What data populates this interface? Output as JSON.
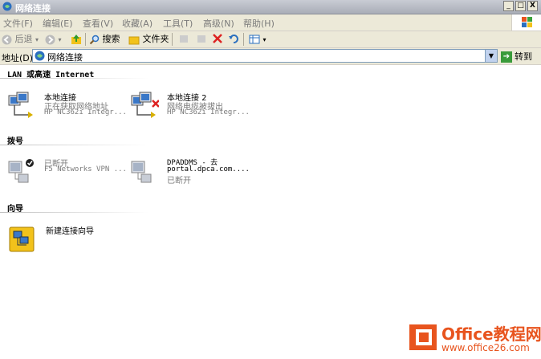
{
  "window": {
    "title": "网络连接",
    "minimize": "_",
    "maximize": "□",
    "close": "X"
  },
  "menu": [
    "文件(F)",
    "编辑(E)",
    "查看(V)",
    "收藏(A)",
    "工具(T)",
    "高级(N)",
    "帮助(H)"
  ],
  "toolbar": {
    "back": "后退",
    "search": "搜索",
    "folders": "文件夹"
  },
  "address": {
    "label": "地址(D)",
    "value": "网络连接",
    "go": "转到"
  },
  "groups": {
    "lan": "LAN 或高速 Internet",
    "dialup": "拨号",
    "wizard": "向导"
  },
  "connections": [
    {
      "name": "本地连接",
      "status": "正在获取网络地址",
      "device": "HP NC362i Integr..."
    },
    {
      "name": "本地连接 2",
      "status": "网络电缆被拔出",
      "device": "HP NC362i Integr..."
    },
    {
      "name": "已断开",
      "status": "F5 Networks VPN ...",
      "device": ""
    },
    {
      "name": "DPADDMS - 去",
      "status": "portal.dpca.com....",
      "device": "已断开"
    },
    {
      "name": "新建连接向导",
      "status": "",
      "device": ""
    }
  ],
  "watermark": {
    "brand": "Office教程网",
    "url": "www.office26.com",
    "colors": {
      "orange": "#e8541e",
      "blue": "#1a6fc4"
    }
  }
}
